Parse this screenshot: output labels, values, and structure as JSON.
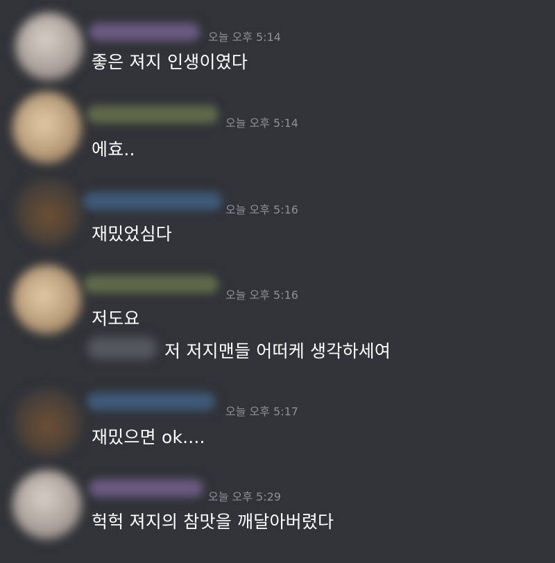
{
  "messages": [
    {
      "timestamp": "오늘 오후 5:14",
      "lines": [
        "좋은 져지 인생이였다"
      ]
    },
    {
      "timestamp": "오늘 오후 5:14",
      "lines": [
        "에효.."
      ]
    },
    {
      "timestamp": "오늘 오후 5:16",
      "lines": [
        "재밌었심다"
      ]
    },
    {
      "timestamp": "오늘 오후 5:16",
      "lines": [
        "저도요",
        "저 저지맨들 어떠케 생각하세여"
      ]
    },
    {
      "timestamp": "오늘 오후 5:17",
      "lines": [
        "재밌으면 ok...."
      ]
    },
    {
      "timestamp": "오늘 오후 5:29",
      "lines": [
        "헉헉 져지의 참맛을 깨달아버렸다"
      ]
    }
  ],
  "colors": {
    "background": "#313338",
    "timestamp": "#8e9297",
    "text": "#ffffff"
  }
}
